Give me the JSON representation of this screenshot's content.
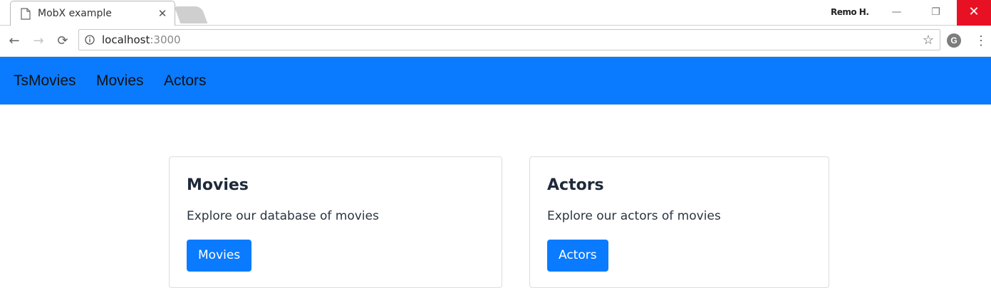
{
  "browser": {
    "tab_title": "MobX example",
    "tab_close": "✕",
    "profile_name": "Remo H.",
    "window_controls": {
      "minimize": "—",
      "restore": "❐",
      "close": "✕"
    },
    "url_host": "localhost",
    "url_port": ":3000",
    "ext_letter": "G"
  },
  "navbar": {
    "brand": "TsMovies",
    "links": [
      "Movies",
      "Actors"
    ],
    "color": "#0a7bff"
  },
  "cards": [
    {
      "title": "Movies",
      "text": "Explore our database of movies",
      "button": "Movies"
    },
    {
      "title": "Actors",
      "text": "Explore our actors of movies",
      "button": "Actors"
    }
  ],
  "colors": {
    "primary": "#0a7bff",
    "close_red": "#e81123"
  }
}
